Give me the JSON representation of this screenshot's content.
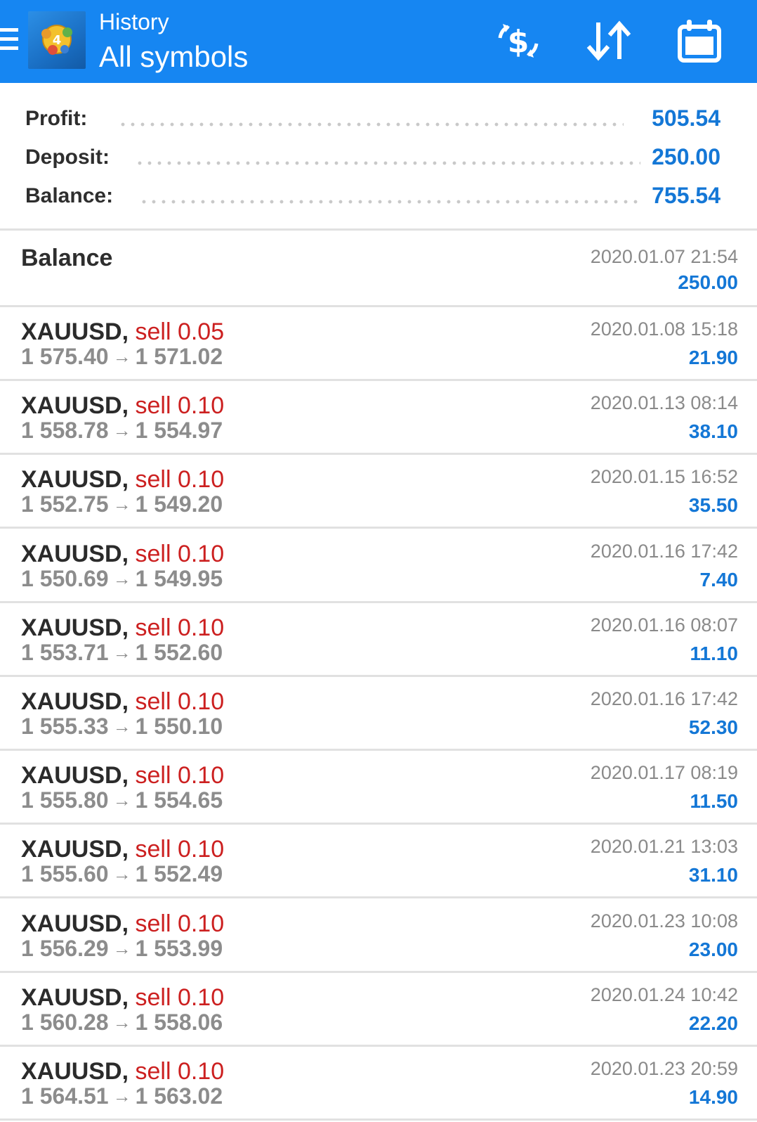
{
  "header": {
    "title_small": "History",
    "title_big": "All symbols",
    "background_color": "#1686f2",
    "icons": [
      "menu-icon",
      "app-logo",
      "currency-exchange-icon",
      "sort-icon",
      "calendar-icon"
    ]
  },
  "summary": {
    "profit_label": "Profit:",
    "profit_value": "505.54",
    "deposit_label": "Deposit:",
    "deposit_value": "250.00",
    "balance_label": "Balance:",
    "balance_value": "755.54"
  },
  "balance_entry": {
    "title": "Balance",
    "date": "2020.01.07 21:54",
    "amount": "250.00"
  },
  "trades": [
    {
      "symbol": "XAUUSD,",
      "type_volume": "sell 0.05",
      "open": "1 575.40",
      "arrow": "→",
      "close": "1 571.02",
      "date": "2020.01.08 15:18",
      "profit": "21.90"
    },
    {
      "symbol": "XAUUSD,",
      "type_volume": "sell 0.10",
      "open": "1 558.78",
      "arrow": "→",
      "close": "1 554.97",
      "date": "2020.01.13 08:14",
      "profit": "38.10"
    },
    {
      "symbol": "XAUUSD,",
      "type_volume": "sell 0.10",
      "open": "1 552.75",
      "arrow": "→",
      "close": "1 549.20",
      "date": "2020.01.15 16:52",
      "profit": "35.50"
    },
    {
      "symbol": "XAUUSD,",
      "type_volume": "sell 0.10",
      "open": "1 550.69",
      "arrow": "→",
      "close": "1 549.95",
      "date": "2020.01.16 17:42",
      "profit": "7.40"
    },
    {
      "symbol": "XAUUSD,",
      "type_volume": "sell 0.10",
      "open": "1 553.71",
      "arrow": "→",
      "close": "1 552.60",
      "date": "2020.01.16 08:07",
      "profit": "11.10"
    },
    {
      "symbol": "XAUUSD,",
      "type_volume": "sell 0.10",
      "open": "1 555.33",
      "arrow": "→",
      "close": "1 550.10",
      "date": "2020.01.16 17:42",
      "profit": "52.30"
    },
    {
      "symbol": "XAUUSD,",
      "type_volume": "sell 0.10",
      "open": "1 555.80",
      "arrow": "→",
      "close": "1 554.65",
      "date": "2020.01.17 08:19",
      "profit": "11.50"
    },
    {
      "symbol": "XAUUSD,",
      "type_volume": "sell 0.10",
      "open": "1 555.60",
      "arrow": "→",
      "close": "1 552.49",
      "date": "2020.01.21 13:03",
      "profit": "31.10"
    },
    {
      "symbol": "XAUUSD,",
      "type_volume": "sell 0.10",
      "open": "1 556.29",
      "arrow": "→",
      "close": "1 553.99",
      "date": "2020.01.23 10:08",
      "profit": "23.00"
    },
    {
      "symbol": "XAUUSD,",
      "type_volume": "sell 0.10",
      "open": "1 560.28",
      "arrow": "→",
      "close": "1 558.06",
      "date": "2020.01.24 10:42",
      "profit": "22.20"
    },
    {
      "symbol": "XAUUSD,",
      "type_volume": "sell 0.10",
      "open": "1 564.51",
      "arrow": "→",
      "close": "1 563.02",
      "date": "2020.01.23 20:59",
      "profit": "14.90"
    }
  ],
  "colors": {
    "accent_blue": "#1477d6",
    "sell_red": "#cc2020",
    "muted_gray": "#8c8c8c"
  }
}
